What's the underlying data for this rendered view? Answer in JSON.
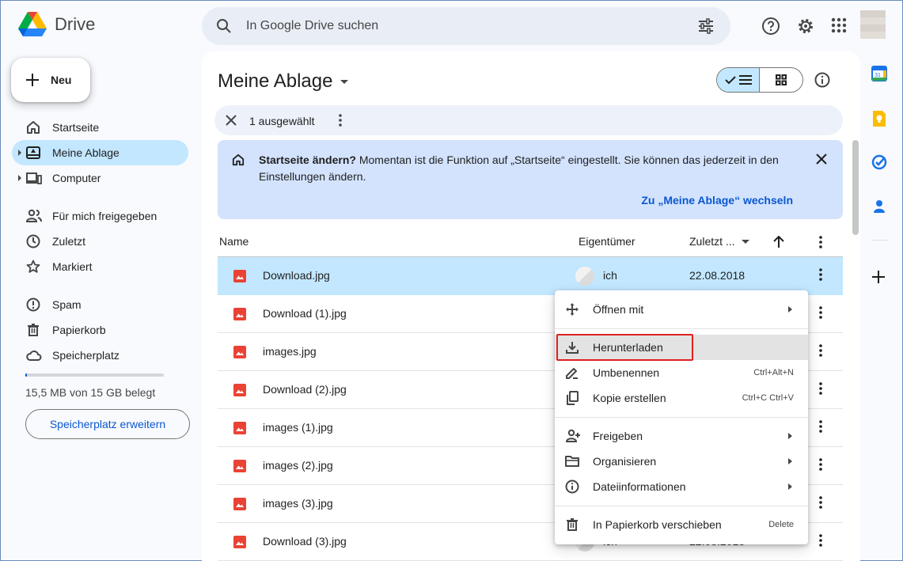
{
  "app": {
    "name": "Drive"
  },
  "search": {
    "placeholder": "In Google Drive suchen"
  },
  "new_button": {
    "label": "Neu"
  },
  "nav": {
    "items": [
      {
        "label": "Startseite",
        "icon": "home-icon"
      },
      {
        "label": "Meine Ablage",
        "icon": "drive-icon",
        "active": true
      },
      {
        "label": "Computer",
        "icon": "computer-icon"
      },
      {
        "label": "Für mich freigegeben",
        "icon": "shared-icon"
      },
      {
        "label": "Zuletzt",
        "icon": "clock-icon"
      },
      {
        "label": "Markiert",
        "icon": "star-icon"
      },
      {
        "label": "Spam",
        "icon": "spam-icon"
      },
      {
        "label": "Papierkorb",
        "icon": "trash-icon"
      },
      {
        "label": "Speicherplatz",
        "icon": "cloud-icon"
      }
    ]
  },
  "storage": {
    "text": "15,5 MB von 15 GB belegt",
    "button": "Speicherplatz erweitern",
    "used_fraction": 0.001
  },
  "main": {
    "title": "Meine Ablage",
    "selection": {
      "count_text": "1 ausgewählt"
    },
    "banner": {
      "bold": "Startseite ändern?",
      "text": " Momentan ist die Funktion auf „Startseite“ eingestellt. Sie können das jederzeit in den Einstellungen ändern.",
      "link": "Zu „Meine Ablage“ wechseln"
    },
    "columns": {
      "name": "Name",
      "owner": "Eigentümer",
      "modified": "Zuletzt ..."
    },
    "files": [
      {
        "name": "Download.jpg",
        "owner": "ich",
        "date": "22.08.2018",
        "selected": true
      },
      {
        "name": "Download (1).jpg",
        "owner": "",
        "date": ""
      },
      {
        "name": "images.jpg",
        "owner": "",
        "date": ""
      },
      {
        "name": "Download (2).jpg",
        "owner": "",
        "date": ""
      },
      {
        "name": "images (1).jpg",
        "owner": "",
        "date": ""
      },
      {
        "name": "images (2).jpg",
        "owner": "",
        "date": ""
      },
      {
        "name": "images (3).jpg",
        "owner": "",
        "date": ""
      },
      {
        "name": "Download (3).jpg",
        "owner": "ich",
        "date": "22.08.2018"
      }
    ]
  },
  "context_menu": {
    "items": [
      {
        "label": "Öffnen mit",
        "icon": "move-icon",
        "submenu": true
      },
      {
        "label": "Herunterladen",
        "icon": "download-icon",
        "highlighted": true
      },
      {
        "label": "Umbenennen",
        "icon": "rename-icon",
        "shortcut": "Ctrl+Alt+N"
      },
      {
        "label": "Kopie erstellen",
        "icon": "copy-icon",
        "shortcut": "Ctrl+C Ctrl+V"
      },
      {
        "label": "Freigeben",
        "icon": "share-icon",
        "submenu": true
      },
      {
        "label": "Organisieren",
        "icon": "folder-icon",
        "submenu": true
      },
      {
        "label": "Dateiinformationen",
        "icon": "info-icon",
        "submenu": true
      },
      {
        "label": "In Papierkorb verschieben",
        "icon": "trash-icon",
        "shortcut": "Delete"
      }
    ]
  },
  "colors": {
    "accent": "#0b57d0",
    "selected": "#c2e7ff",
    "banner": "#d3e3fd",
    "highlight_box": "#e02020",
    "file_icon": "#ea4335"
  }
}
